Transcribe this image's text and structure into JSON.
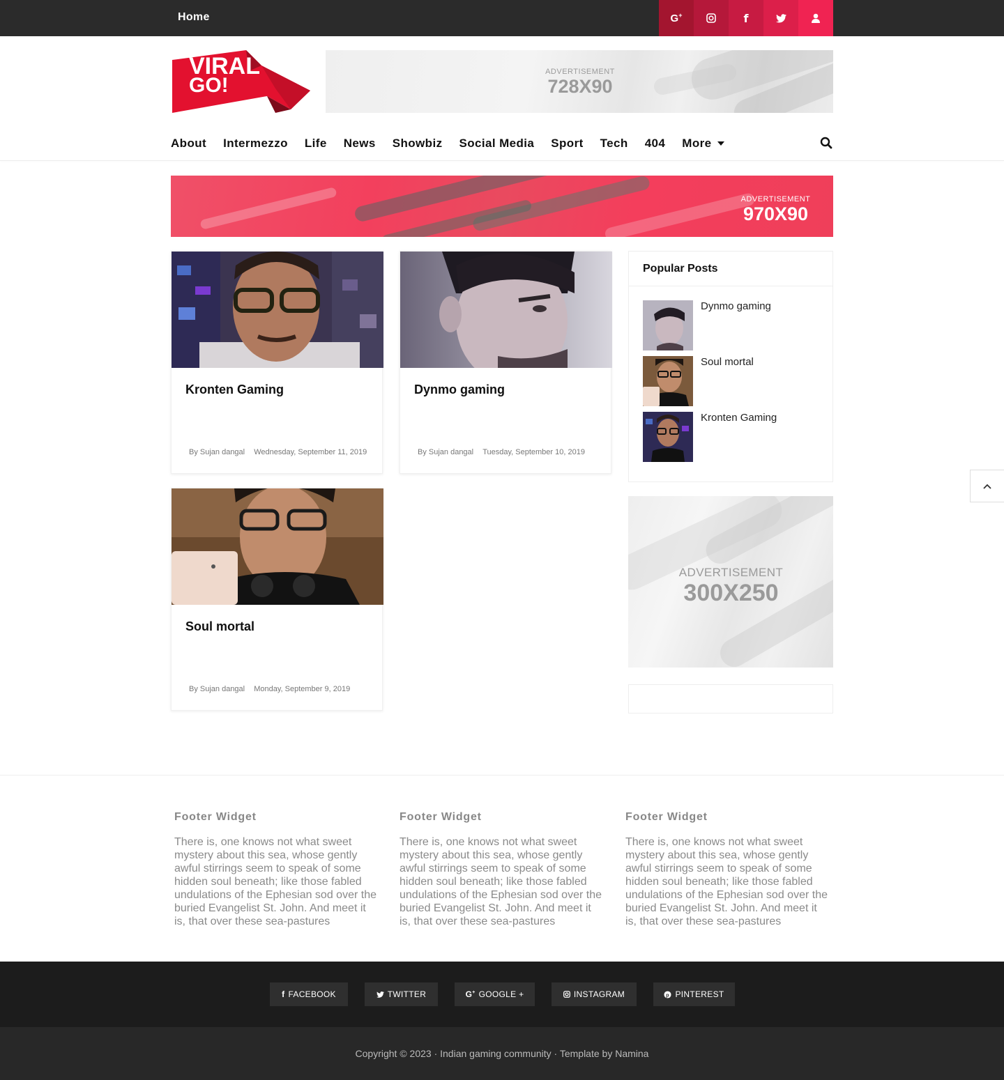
{
  "topbar": {
    "home": "Home",
    "socials": [
      {
        "icon": "google-plus-icon",
        "glyph": "G+",
        "color": "#a3152f"
      },
      {
        "icon": "instagram-icon",
        "glyph": "◎",
        "color": "#b5183a"
      },
      {
        "icon": "facebook-icon",
        "glyph": "f",
        "color": "#c71b42"
      },
      {
        "icon": "twitter-icon",
        "glyph": "🐦",
        "color": "#dc1f4a"
      },
      {
        "icon": "user-icon",
        "glyph": "👤",
        "color": "#f02352"
      }
    ]
  },
  "logo": {
    "line1": "VIRAL",
    "line2": "GO!"
  },
  "ads": {
    "leaderboard": {
      "label": "ADVERTISEMENT",
      "size": "728X90"
    },
    "wide": {
      "label": "ADVERTISEMENT",
      "size": "970X90"
    },
    "sidebar": {
      "label": "ADVERTISEMENT",
      "size": "300X250"
    }
  },
  "nav": {
    "items": [
      "About",
      "Intermezzo",
      "Life",
      "News",
      "Showbiz",
      "Social Media",
      "Sport",
      "Tech",
      "404"
    ],
    "more": "More"
  },
  "posts": [
    {
      "title": "Kronten Gaming",
      "author": "By Sujan dangal",
      "date": "Wednesday, September 11, 2019"
    },
    {
      "title": "Dynmo gaming",
      "author": "By Sujan dangal",
      "date": "Tuesday, September 10, 2019"
    },
    {
      "title": "Soul mortal",
      "author": "By Sujan dangal",
      "date": "Monday, September 9, 2019"
    }
  ],
  "popular": {
    "heading": "Popular Posts",
    "items": [
      "Dynmo gaming",
      "Soul mortal",
      "Kronten Gaming"
    ]
  },
  "footer": {
    "widgets": [
      {
        "title": "Footer Widget",
        "text": "There is, one knows not what sweet mystery about this sea, whose gently awful stirrings seem to speak of some hidden soul beneath; like those fabled undulations of the Ephesian sod over the buried Evangelist St. John. And meet it is, that over these sea-pastures"
      },
      {
        "title": "Footer Widget",
        "text": "There is, one knows not what sweet mystery about this sea, whose gently awful stirrings seem to speak of some hidden soul beneath; like those fabled undulations of the Ephesian sod over the buried Evangelist St. John. And meet it is, that over these sea-pastures"
      },
      {
        "title": "Footer Widget",
        "text": "There is, one knows not what sweet mystery about this sea, whose gently awful stirrings seem to speak of some hidden soul beneath; like those fabled undulations of the Ephesian sod over the buried Evangelist St. John. And meet it is, that over these sea-pastures"
      }
    ],
    "social_buttons": [
      {
        "icon": "facebook-icon",
        "label": "FACEBOOK"
      },
      {
        "icon": "twitter-icon",
        "label": "TWITTER"
      },
      {
        "icon": "google-plus-icon",
        "label": "GOOGLE +"
      },
      {
        "icon": "instagram-icon",
        "label": "INSTAGRAM"
      },
      {
        "icon": "pinterest-icon",
        "label": "PINTEREST"
      }
    ],
    "copyright": "Copyright © 2023 · Indian gaming community · Template by Namina"
  },
  "colors": {
    "brand_red": "#e3112f",
    "topbar_bg": "#2b2b2b",
    "footer_dark": "#1c1c1c"
  }
}
